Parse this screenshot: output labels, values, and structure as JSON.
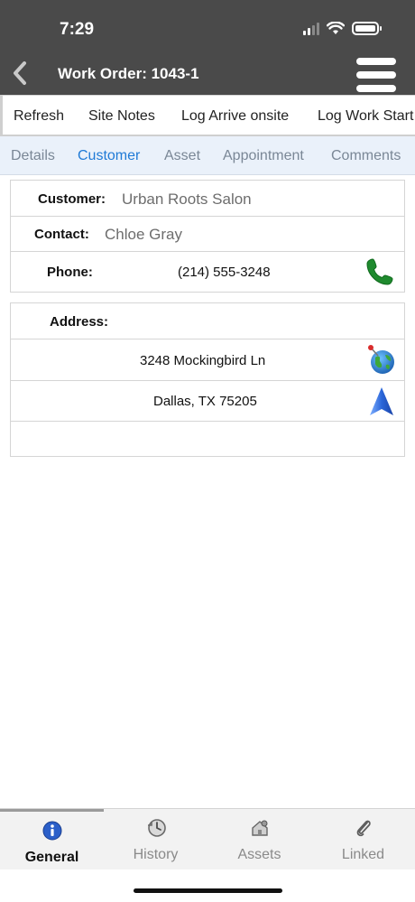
{
  "status_bar": {
    "time": "7:29"
  },
  "header": {
    "title": "Work Order: 1043-1"
  },
  "toolbar": {
    "buttons": [
      "Refresh",
      "Site Notes",
      "Log Arrive onsite",
      "Log Work Start"
    ]
  },
  "tabs": {
    "items": [
      "Details",
      "Customer",
      "Asset",
      "Appointment",
      "Comments"
    ],
    "active": "Customer"
  },
  "customer": {
    "customer_label": "Customer:",
    "customer_value": "Urban Roots Salon",
    "contact_label": "Contact:",
    "contact_value": "Chloe Gray",
    "phone_label": "Phone:",
    "phone_value": "(214) 555-3248"
  },
  "address": {
    "label": "Address:",
    "line1": "3248 Mockingbird Ln",
    "line2": "Dallas, TX 75205"
  },
  "bottom_nav": {
    "items": [
      {
        "label": "General",
        "icon": "info-icon"
      },
      {
        "label": "History",
        "icon": "history-icon"
      },
      {
        "label": "Assets",
        "icon": "assets-icon"
      },
      {
        "label": "Linked",
        "icon": "paperclip-icon"
      }
    ],
    "active": "General"
  },
  "colors": {
    "header_bg": "#4a4a4a",
    "tab_active": "#1f7ad6",
    "phone_green": "#1f8a2e",
    "nav_blue": "#2b66d9"
  }
}
